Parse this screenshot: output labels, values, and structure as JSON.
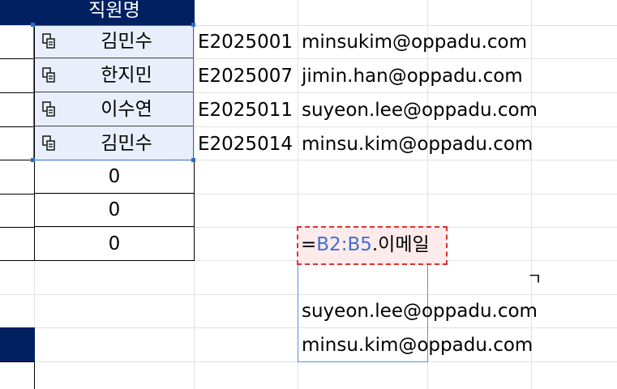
{
  "header": {
    "col_b_title": "직원명"
  },
  "rows": [
    {
      "name": "김민수",
      "id": "E2025001",
      "email": "minsukim@oppadu.com"
    },
    {
      "name": "한지민",
      "id": "E2025007",
      "email": "jimin.han@oppadu.com"
    },
    {
      "name": "이수연",
      "id": "E2025011",
      "email": "suyeon.lee@oppadu.com"
    },
    {
      "name": "김민수",
      "id": "E2025014",
      "email": "minsu.kim@oppadu.com"
    }
  ],
  "zeros": [
    "0",
    "0",
    "0"
  ],
  "formula": {
    "eq": "=",
    "ref": "B2:B5",
    "suffix": ".이메일"
  },
  "partial_glyph": "ㄱ",
  "spill": [
    "suyeon.lee@oppadu.com",
    "minsu.kim@oppadu.com"
  ],
  "icons": {
    "linked_data": "linked-data-type-icon"
  },
  "colors": {
    "header_bg": "#002060",
    "selection": "#2e6bc9",
    "formula_ref": "#3f6fd1",
    "highlight_border": "#e03030",
    "highlight_bg": "#fdeaea"
  }
}
